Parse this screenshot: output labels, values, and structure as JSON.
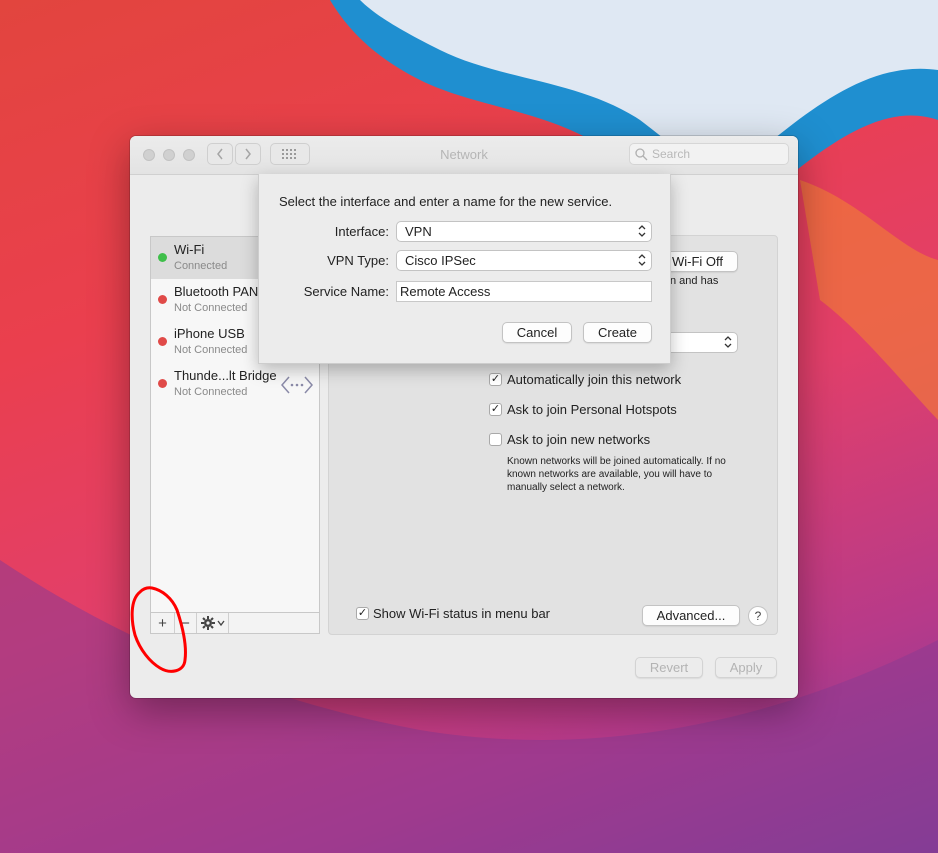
{
  "window": {
    "title": "Network"
  },
  "search": {
    "placeholder": "Search"
  },
  "colors": {
    "connected": "#3fbf4a",
    "not_connected": "#e04a48",
    "annotation": "#ff0000"
  },
  "services": [
    {
      "name": "Wi-Fi",
      "status": "Connected",
      "state": "connected"
    },
    {
      "name": "Bluetooth PAN",
      "status": "Not Connected",
      "state": "not_connected"
    },
    {
      "name": "iPhone USB",
      "status": "Not Connected",
      "state": "not_connected"
    },
    {
      "name": "Thunde...lt Bridge",
      "status": "Not Connected",
      "state": "not_connected",
      "icon": "bridge-arrows-icon"
    }
  ],
  "sidebar_toolbar": {
    "add": "+",
    "remove": "−",
    "action": "gear-icon"
  },
  "sheet": {
    "prompt": "Select the interface and enter a name for the new service.",
    "interface_label": "Interface:",
    "interface_value": "VPN",
    "vpn_type_label": "VPN Type:",
    "vpn_type_value": "Cisco IPSec",
    "service_name_label": "Service Name:",
    "service_name_value": "Remote Access",
    "cancel": "Cancel",
    "create": "Create"
  },
  "wifi": {
    "turn_off": "Wi-Fi Off",
    "status_fragment": "n and has",
    "auto_join": {
      "label": "Automatically join this network",
      "checked": true
    },
    "ask_hotspots": {
      "label": "Ask to join Personal Hotspots",
      "checked": true
    },
    "ask_new": {
      "label": "Ask to join new networks",
      "checked": false
    },
    "note": "Known networks will be joined automatically. If no known networks are available, you will have to manually select a network.",
    "show_status": {
      "label": "Show Wi-Fi status in menu bar",
      "checked": true
    },
    "advanced": "Advanced...",
    "help": "?"
  },
  "footer": {
    "revert": "Revert",
    "apply": "Apply"
  },
  "check_glyph": "✓"
}
